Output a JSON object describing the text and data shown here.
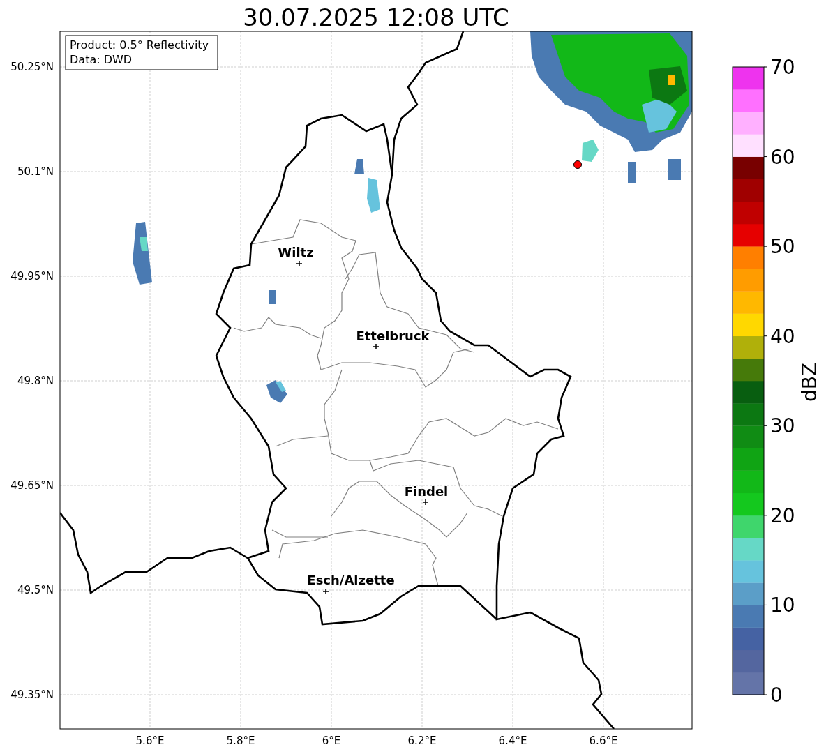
{
  "title": "30.07.2025 12:08 UTC",
  "info_box": {
    "lines": [
      "Product: 0.5° Reflectivity",
      "Data: DWD"
    ]
  },
  "map": {
    "xticks": [
      "5.6°E",
      "5.8°E",
      "6°E",
      "6.2°E",
      "6.4°E",
      "6.6°E"
    ],
    "yticks": [
      "50.25°N",
      "50.1°N",
      "49.95°N",
      "49.8°N",
      "49.65°N",
      "49.5°N",
      "49.35°N"
    ],
    "places": [
      "Wiltz",
      "Ettelbruck",
      "Findel",
      "Esch/Alzette"
    ]
  },
  "colorbar": {
    "label": "dBZ",
    "ticks": [
      "70",
      "60",
      "50",
      "40",
      "30",
      "20",
      "10",
      "0"
    ],
    "bins": [
      {
        "color": "#6474a8"
      },
      {
        "color": "#54669f"
      },
      {
        "color": "#4562a3"
      },
      {
        "color": "#4a7ab2"
      },
      {
        "color": "#5b9ec8"
      },
      {
        "color": "#66c3dd"
      },
      {
        "color": "#66d8c6"
      },
      {
        "color": "#3fd66c"
      },
      {
        "color": "#14c81e"
      },
      {
        "color": "#12b818"
      },
      {
        "color": "#10a414"
      },
      {
        "color": "#108c14"
      },
      {
        "color": "#0c7812"
      },
      {
        "color": "#085e10"
      },
      {
        "color": "#467a0a"
      },
      {
        "color": "#b0b00a"
      },
      {
        "color": "#ffd800"
      },
      {
        "color": "#ffb800"
      },
      {
        "color": "#ff9c00"
      },
      {
        "color": "#ff7f00"
      },
      {
        "color": "#e60000"
      },
      {
        "color": "#c00000"
      },
      {
        "color": "#a00000"
      },
      {
        "color": "#780000"
      },
      {
        "color": "#ffe0ff"
      },
      {
        "color": "#ffb0ff"
      },
      {
        "color": "#ff70ff"
      },
      {
        "color": "#ee33ee"
      }
    ]
  }
}
